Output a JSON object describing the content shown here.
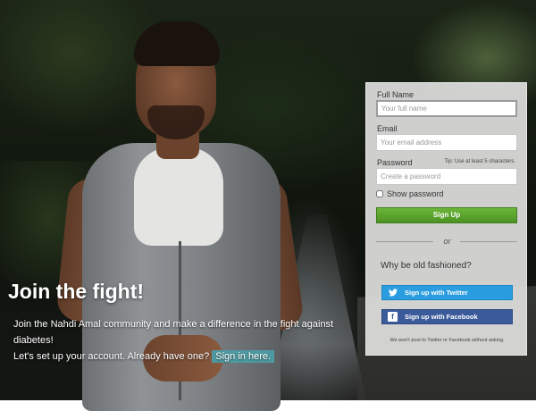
{
  "hero": {
    "title": "Join the fight!",
    "line1": "Join the Nahdi Amal community and make a difference in the fight against diabetes!",
    "line2": "Let's set up your account. Already have one?",
    "signin_link": "Sign in here."
  },
  "form": {
    "full_name_label": "Full Name",
    "full_name_placeholder": "Your full name",
    "email_label": "Email",
    "email_placeholder": "Your email address",
    "password_label": "Password",
    "password_tip": "Tip: Use at least 5 characters.",
    "password_placeholder": "Create a password",
    "show_password_label": "Show password",
    "show_password_checked": false,
    "signup_button": "Sign Up",
    "or_text": "or",
    "alt_heading": "Why be old fashioned?",
    "twitter_button": "Sign up with Twitter",
    "facebook_button": "Sign up with Facebook",
    "disclaimer": "We won't post to Twitter or Facebook without asking."
  },
  "icons": {
    "twitter": "twitter-bird-icon",
    "facebook": "facebook-f-icon"
  },
  "colors": {
    "signup_green": "#5aa62e",
    "twitter_blue": "#2a9de0",
    "facebook_blue": "#3b5a99",
    "link_teal": "#4f9aa2"
  }
}
